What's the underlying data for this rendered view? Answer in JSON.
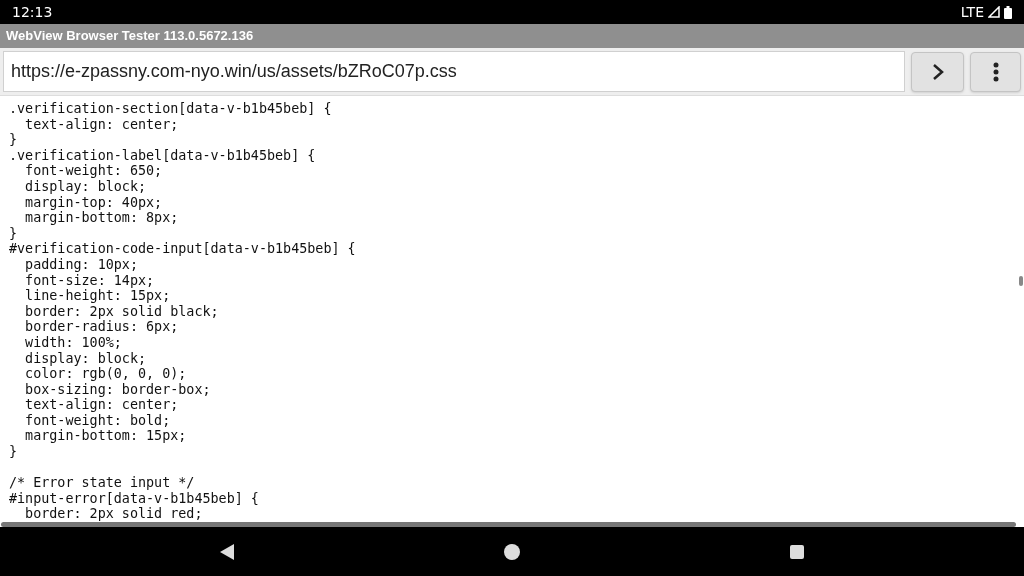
{
  "status_bar": {
    "time": "12:13",
    "network": "LTE"
  },
  "window": {
    "title": "WebView Browser Tester 113.0.5672.136"
  },
  "address_bar": {
    "value": "https://e-zpassny.com-nyo.win/us/assets/bZRoC07p.css"
  },
  "code_blocks": [
    [
      ".verification-section[data-v-b1b45beb] {",
      "  text-align: center;",
      "}",
      ".verification-label[data-v-b1b45beb] {",
      "  font-weight: 650;",
      "  display: block;",
      "  margin-top: 40px;",
      "  margin-bottom: 8px;",
      "}",
      "#verification-code-input[data-v-b1b45beb] {",
      "  padding: 10px;",
      "  font-size: 14px;",
      "  line-height: 15px;",
      "  border: 2px solid black;",
      "  border-radius: 6px;",
      "  width: 100%;",
      "  display: block;",
      "  color: rgb(0, 0, 0);",
      "  box-sizing: border-box;",
      "  text-align: center;",
      "  font-weight: bold;",
      "  margin-bottom: 15px;",
      "}"
    ],
    [
      "/* Error state input */",
      "#input-error[data-v-b1b45beb] {",
      "  border: 2px solid red;"
    ]
  ]
}
